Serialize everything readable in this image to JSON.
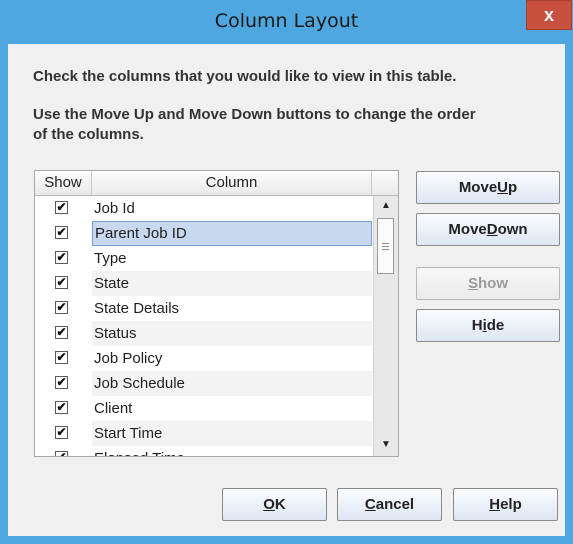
{
  "window": {
    "title": "Column Layout",
    "close_glyph": "x"
  },
  "instructions": {
    "line1": "Check the columns that you would like to view in this table.",
    "line2a": "Use the Move Up and Move Down buttons to change the order",
    "line2b": "of the columns."
  },
  "table": {
    "headers": {
      "show": "Show",
      "column": "Column"
    },
    "rows": [
      {
        "label": "Job Id",
        "checked": true
      },
      {
        "label": "Parent Job ID",
        "checked": true,
        "selected": true
      },
      {
        "label": "Type",
        "checked": true
      },
      {
        "label": "State",
        "checked": true
      },
      {
        "label": "State Details",
        "checked": true
      },
      {
        "label": "Status",
        "checked": true
      },
      {
        "label": "Job Policy",
        "checked": true
      },
      {
        "label": "Job Schedule",
        "checked": true
      },
      {
        "label": "Client",
        "checked": true
      },
      {
        "label": "Start Time",
        "checked": true
      },
      {
        "label": "Elapsed Time",
        "checked": true
      }
    ]
  },
  "side_buttons": {
    "move_up": {
      "pre": "Move ",
      "key": "U",
      "post": "p"
    },
    "move_down": {
      "pre": "Move ",
      "key": "D",
      "post": "own"
    },
    "show": {
      "pre": "",
      "key": "S",
      "post": "how"
    },
    "hide": {
      "pre": "H",
      "key": "i",
      "post": "de"
    }
  },
  "bottom_buttons": {
    "ok": {
      "key": "O",
      "post": "K"
    },
    "cancel": {
      "key": "C",
      "post": "ancel"
    },
    "help": {
      "key": "H",
      "post": "elp"
    }
  },
  "colors": {
    "frame": "#4ea7de",
    "close": "#c7503f",
    "selection": "#c8d8ee"
  }
}
